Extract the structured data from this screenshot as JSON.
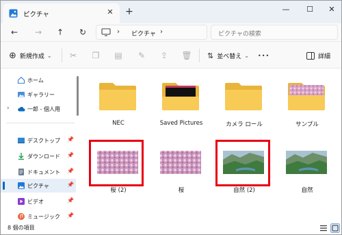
{
  "window": {
    "tab_title": "ピクチャ",
    "tab_close": "✕",
    "new_tab": "+",
    "controls": {
      "minimize": "—",
      "maximize": "☐",
      "close": "✕"
    }
  },
  "nav": {
    "back": "←",
    "forward": "→",
    "up": "↑",
    "refresh": "↻",
    "path": [
      "ピクチャ"
    ],
    "path_separator": "›",
    "search_placeholder": "ピクチャの検索"
  },
  "commands": {
    "new_label": "新規作成",
    "sort_label": "並べ替え",
    "more": "•••",
    "details_label": "詳細"
  },
  "sidebar": {
    "items": [
      {
        "label": "ホーム",
        "icon": "home-icon"
      },
      {
        "label": "ギャラリー",
        "icon": "gallery-icon"
      },
      {
        "label": "一郎 - 個人用",
        "icon": "cloud-icon"
      },
      {
        "label": "デスクトップ",
        "icon": "desktop-icon",
        "pinned": true
      },
      {
        "label": "ダウンロード",
        "icon": "download-icon",
        "pinned": true
      },
      {
        "label": "ドキュメント",
        "icon": "document-icon",
        "pinned": true
      },
      {
        "label": "ピクチャ",
        "icon": "pictures-icon",
        "pinned": true,
        "active": true
      },
      {
        "label": "ビデオ",
        "icon": "video-icon",
        "pinned": true
      },
      {
        "label": "ミュージック",
        "icon": "music-icon",
        "pinned": true
      }
    ],
    "pin_glyph": "📌"
  },
  "files": [
    {
      "name": "NEC",
      "type": "folder"
    },
    {
      "name": "Saved Pictures",
      "type": "folder"
    },
    {
      "name": "カメラ ロール",
      "type": "folder"
    },
    {
      "name": "サンプル",
      "type": "folder"
    },
    {
      "name": "桜 (2)",
      "type": "image",
      "highlighted": true
    },
    {
      "name": "桜",
      "type": "image"
    },
    {
      "name": "自然 (2)",
      "type": "image",
      "highlighted": true
    },
    {
      "name": "自然",
      "type": "image"
    }
  ],
  "status": {
    "item_count": "8 個の項目"
  },
  "colors": {
    "accent": "#0067c0",
    "highlight": "#e60012",
    "folder": "#f5c542"
  }
}
